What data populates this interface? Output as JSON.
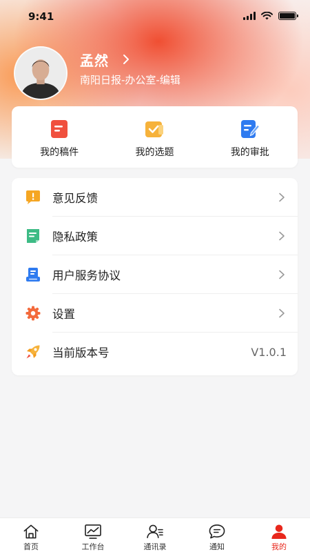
{
  "status_bar": {
    "time": "9:41"
  },
  "profile": {
    "name": "孟然",
    "organization": "南阳日报-办公室-编辑"
  },
  "quick_actions": [
    {
      "label": "我的稿件",
      "icon": "document-icon",
      "color": "#f0503e"
    },
    {
      "label": "我的选题",
      "icon": "checked-folder-icon",
      "color": "#f6b23b"
    },
    {
      "label": "我的审批",
      "icon": "edit-document-icon",
      "color": "#2f7bf0"
    }
  ],
  "menu": [
    {
      "label": "意见反馈",
      "icon": "feedback-icon",
      "color": "#f5a623"
    },
    {
      "label": "隐私政策",
      "icon": "privacy-document-icon",
      "color": "#3dbb85"
    },
    {
      "label": "用户服务协议",
      "icon": "agreement-icon",
      "color": "#2f7bf0"
    },
    {
      "label": "设置",
      "icon": "gear-icon",
      "color": "#f36a3c"
    },
    {
      "label": "当前版本号",
      "icon": "rocket-icon",
      "color": "#f6b23b",
      "value": "V1.0.1"
    }
  ],
  "tab_bar": [
    {
      "label": "首页",
      "icon": "home-icon"
    },
    {
      "label": "工作台",
      "icon": "workbench-chart-icon"
    },
    {
      "label": "通讯录",
      "icon": "contacts-icon"
    },
    {
      "label": "通知",
      "icon": "message-bubble-icon"
    },
    {
      "label": "我的",
      "icon": "user-icon",
      "active": true
    }
  ],
  "colors": {
    "accent": "#e8271c",
    "hero_red": "#f0463c",
    "hero_orange": "#fa8c3c"
  }
}
